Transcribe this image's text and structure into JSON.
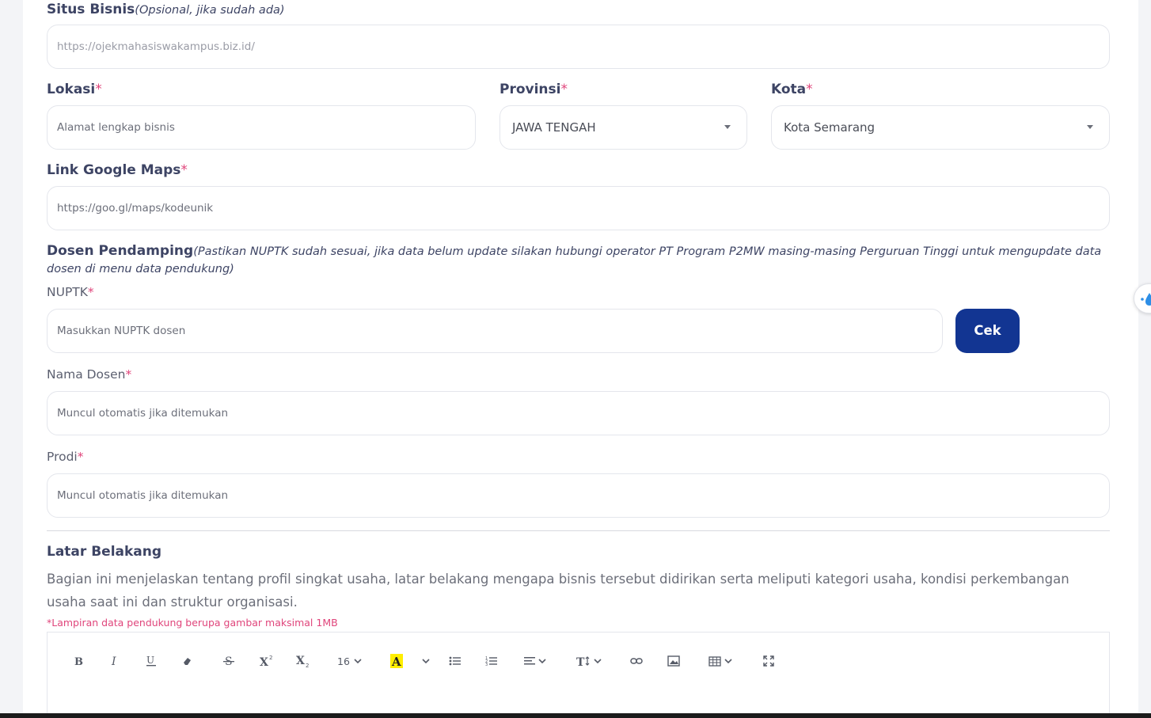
{
  "business_site": {
    "label": "Situs Bisnis",
    "hint": "(Opsional, jika sudah ada)",
    "placeholder": "https://ojekmahasiswakampus.biz.id/"
  },
  "location": {
    "label": "Lokasi",
    "required": "*",
    "placeholder": "Alamat lengkap bisnis"
  },
  "province": {
    "label": "Provinsi",
    "required": "*",
    "value": "JAWA TENGAH"
  },
  "city": {
    "label": "Kota",
    "required": "*",
    "value": "Kota Semarang"
  },
  "maps": {
    "label": "Link Google Maps",
    "required": "*",
    "placeholder": "https://goo.gl/maps/kodeunik"
  },
  "lecturer": {
    "label": "Dosen Pendamping",
    "hint_line1": "(Pastikan NUPTK sudah sesuai, jika data belum update silakan hubungi operator PT Program P2MW masing-masing Perguruan Tinggi untuk mengupdate data",
    "hint_line2": "dosen di menu data pendukung)",
    "nuptk_label": "NUPTK",
    "nuptk_placeholder": "Masukkan NUPTK dosen",
    "check_button": "Cek",
    "name_label": "Nama Dosen",
    "name_placeholder": "Muncul otomatis jika ditemukan",
    "prodi_label": "Prodi",
    "prodi_placeholder": "Muncul otomatis jika ditemukan",
    "required": "*"
  },
  "background": {
    "title": "Latar Belakang",
    "description": "Bagian ini menjelaskan tentang profil singkat usaha, latar belakang mengapa bisnis tersebut didirikan serta meliputi kategori usaha, kondisi perkembangan usaha saat ini dan struktur organisasi.",
    "note": "*Lampiran data pendukung berupa gambar maksimal 1MB"
  },
  "editor_toolbar": {
    "font_size": "16",
    "tools": [
      "bold-icon",
      "italic-icon",
      "underline-icon",
      "eraser-icon",
      "strikethrough-icon",
      "superscript-icon",
      "subscript-icon",
      "font-size-dropdown",
      "highlight-color-icon",
      "color-chevron-icon",
      "bullet-list-icon",
      "numbered-list-icon",
      "align-icon",
      "line-height-icon",
      "link-icon",
      "image-icon",
      "table-icon",
      "fullscreen-icon"
    ]
  },
  "colors": {
    "accent": "#123592",
    "required": "#e0457b",
    "label": "#3d4464"
  }
}
